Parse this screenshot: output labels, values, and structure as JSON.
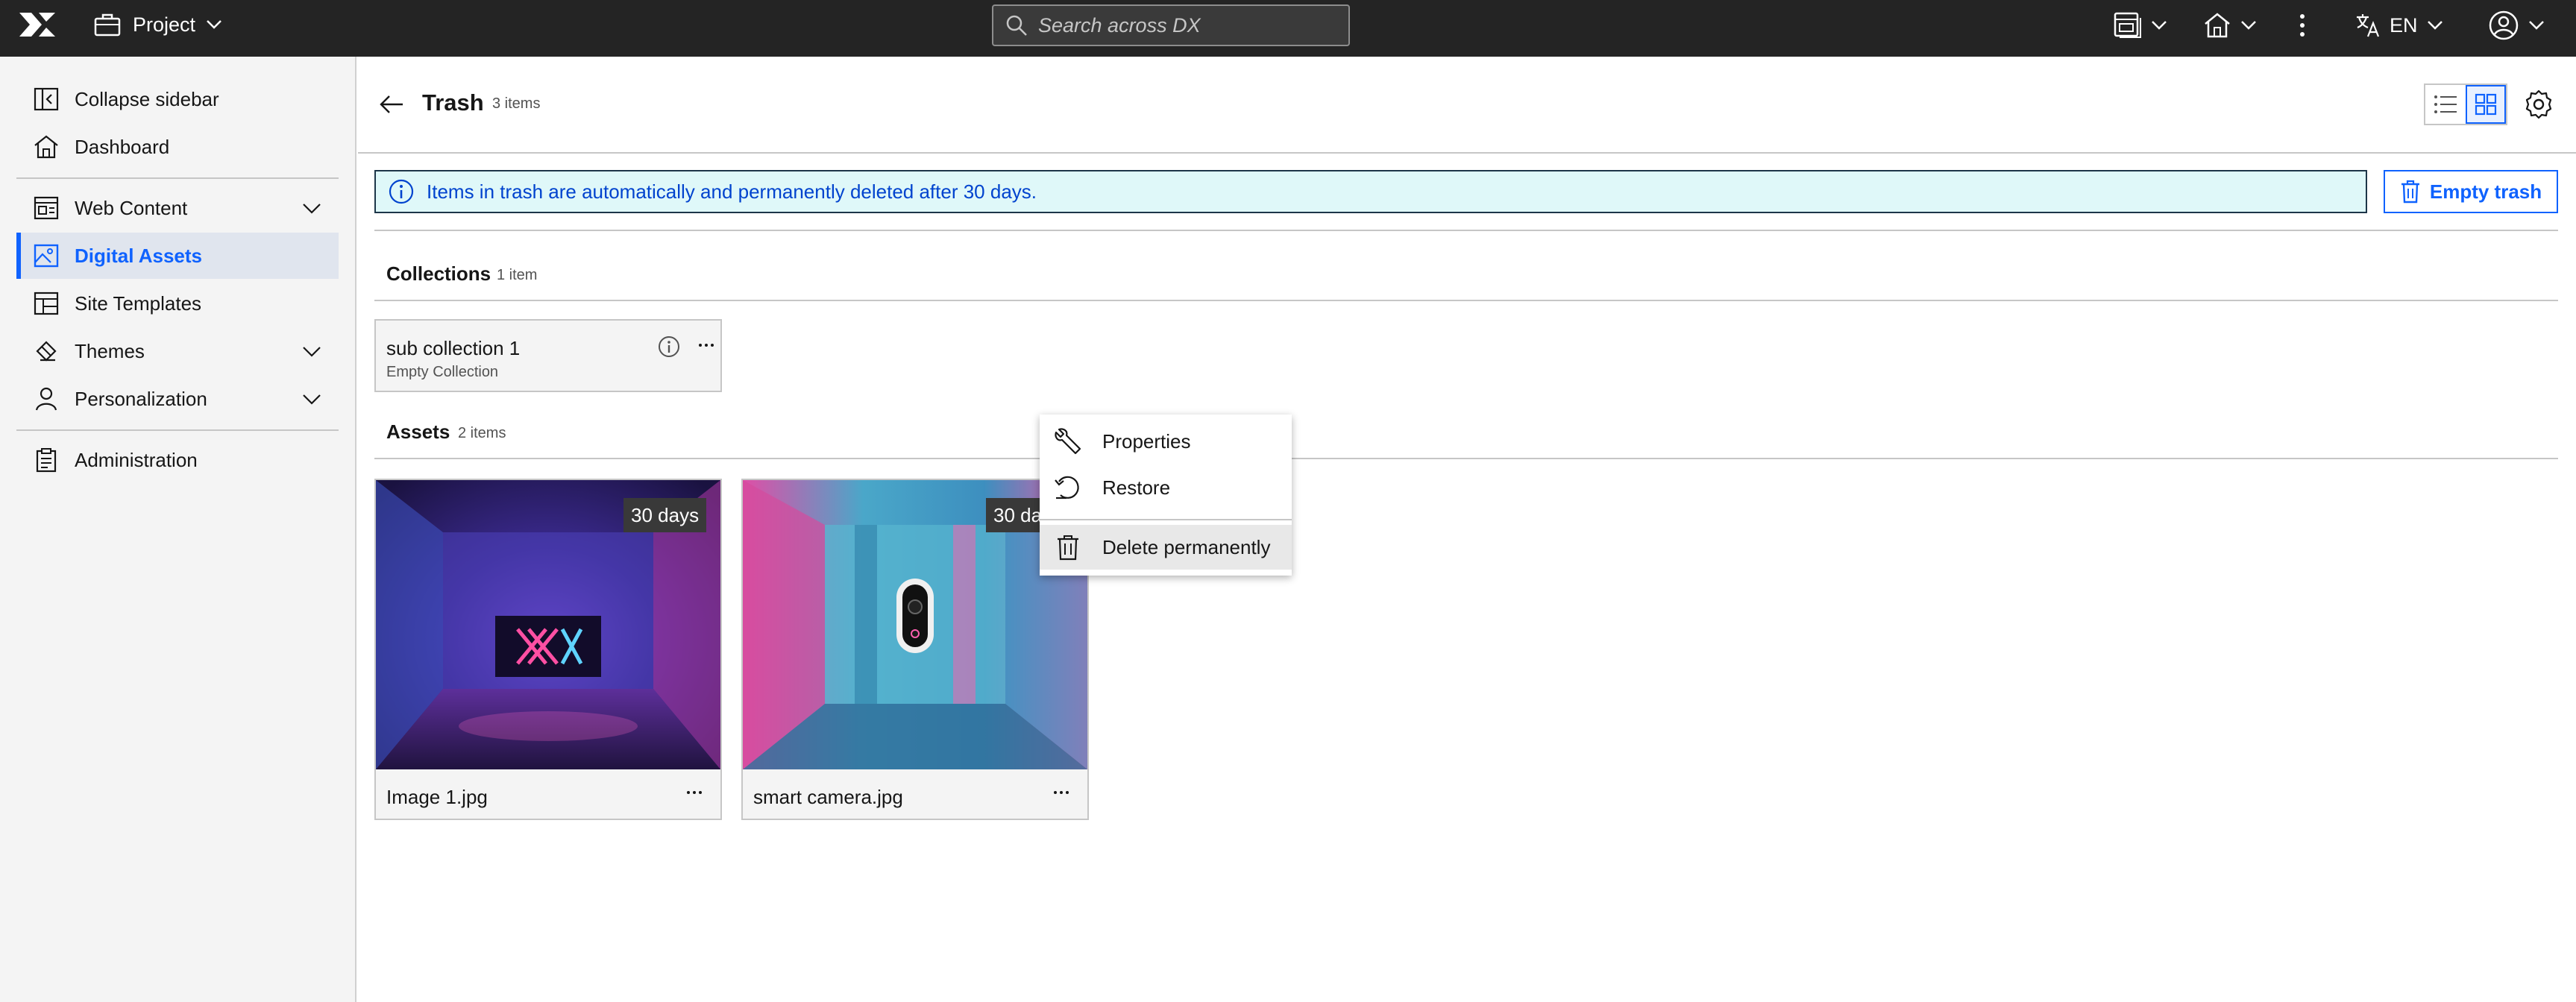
{
  "topbar": {
    "project_label": "Project",
    "search_placeholder": "Search across DX",
    "language": "EN"
  },
  "sidebar": {
    "items": [
      {
        "label": "Collapse sidebar",
        "icon": "collapse-sidebar-icon"
      },
      {
        "label": "Dashboard",
        "icon": "home-icon"
      },
      {
        "label": "Web Content",
        "icon": "web-content-icon",
        "expandable": true
      },
      {
        "label": "Digital Assets",
        "icon": "image-icon",
        "active": true
      },
      {
        "label": "Site Templates",
        "icon": "template-icon"
      },
      {
        "label": "Themes",
        "icon": "paint-icon",
        "expandable": true
      },
      {
        "label": "Personalization",
        "icon": "user-icon",
        "expandable": true
      },
      {
        "label": "Administration",
        "icon": "clipboard-icon"
      }
    ]
  },
  "main": {
    "title": "Trash",
    "count": "3 items",
    "info_banner": "Items in trash are automatically and permanently deleted after 30 days.",
    "empty_trash_label": "Empty trash",
    "collections": {
      "title": "Collections",
      "count": "1 item",
      "items": [
        {
          "name": "sub collection 1",
          "subtitle": "Empty Collection"
        }
      ]
    },
    "assets": {
      "title": "Assets",
      "count": "2 items",
      "items": [
        {
          "name": "Image 1.jpg",
          "badge": "30 days"
        },
        {
          "name": "smart camera.jpg",
          "badge": "30 days"
        }
      ]
    },
    "context_menu": {
      "items": [
        {
          "label": "Properties",
          "icon": "wrench-icon"
        },
        {
          "label": "Restore",
          "icon": "restore-icon"
        },
        {
          "label": "Delete permanently",
          "icon": "trash-icon"
        }
      ]
    }
  },
  "colors": {
    "topbar": "#242424",
    "accent": "#0f62fe",
    "info_bg": "#dff8f9"
  }
}
